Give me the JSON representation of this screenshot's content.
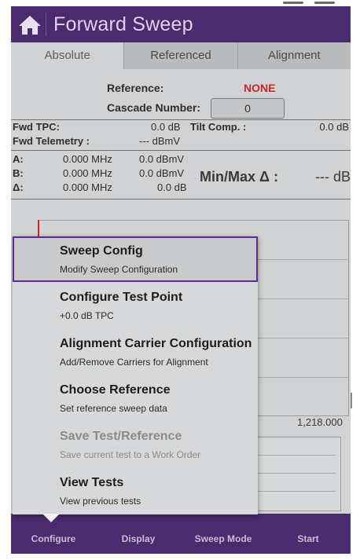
{
  "header": {
    "title": "Forward Sweep",
    "home_icon": "home-icon"
  },
  "tabs": [
    {
      "label": "Absolute",
      "active": true
    },
    {
      "label": "Referenced",
      "active": false
    },
    {
      "label": "Alignment",
      "active": false
    }
  ],
  "reference": {
    "label": "Reference:",
    "value": "NONE",
    "value_color": "#c62828",
    "cascade_label": "Cascade Number:",
    "cascade_value": "0"
  },
  "fwd": {
    "tpc_label": "Fwd TPC:",
    "tpc_value": "0.0 dB",
    "tilt_label": "Tilt Comp. :",
    "tilt_value": "0.0 dB",
    "telemetry_label": "Fwd Telemetry :",
    "telemetry_value": "--- dBmV"
  },
  "markers": [
    {
      "label": "A:",
      "freq": "0.000 MHz",
      "level": "0.0 dBmV"
    },
    {
      "label": "B:",
      "freq": "0.000 MHz",
      "level": "0.0 dBmV"
    },
    {
      "label": "Δ:",
      "freq": "0.000 MHz",
      "level": "0.0 dB"
    }
  ],
  "minmax": {
    "label": "Min/Max Δ :",
    "value": "--- dB"
  },
  "graph": {
    "freq_end": "1,218.000"
  },
  "menu": {
    "items": [
      {
        "title": "Sweep Config",
        "subtitle": "Modify Sweep Configuration",
        "selected": true,
        "enabled": true
      },
      {
        "title": "Configure Test Point",
        "subtitle": "+0.0 dB TPC",
        "selected": false,
        "enabled": true
      },
      {
        "title": "Alignment Carrier Configuration",
        "subtitle": "Add/Remove Carriers for Alignment",
        "selected": false,
        "enabled": true
      },
      {
        "title": "Choose Reference",
        "subtitle": "Set reference sweep data",
        "selected": false,
        "enabled": true
      },
      {
        "title": "Save Test/Reference",
        "subtitle": "Save current test to a Work Order",
        "selected": false,
        "enabled": false
      },
      {
        "title": "View Tests",
        "subtitle": "View previous tests",
        "selected": false,
        "enabled": true
      }
    ]
  },
  "bottom_nav": [
    {
      "label": "Configure"
    },
    {
      "label": "Display"
    },
    {
      "label": "Sweep Mode"
    },
    {
      "label": "Start"
    }
  ],
  "colors": {
    "header": "#4a2b6e",
    "accent": "#5b2d8e",
    "background": "#d0d2d3"
  }
}
